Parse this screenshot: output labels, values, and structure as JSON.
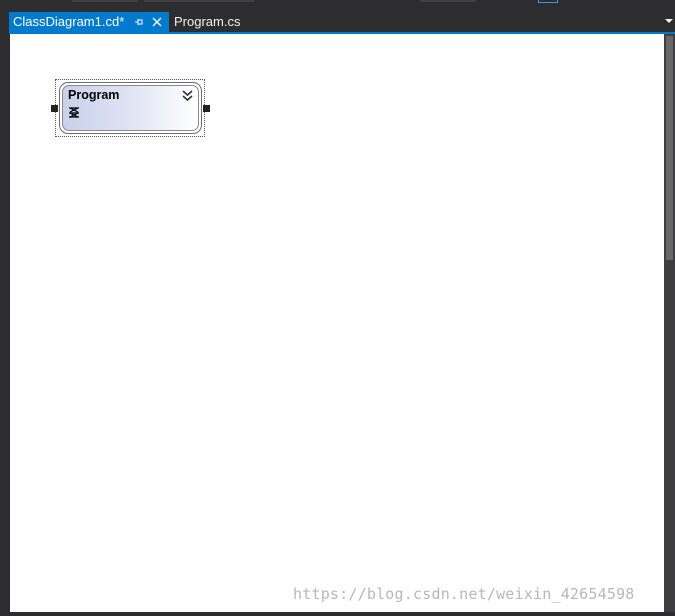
{
  "tabs": [
    {
      "label": "ClassDiagram1.cd*",
      "active": true
    },
    {
      "label": "Program.cs",
      "active": false
    }
  ],
  "tab_icons": {
    "pin": "pin-icon",
    "close": "close-icon",
    "overflow": "chevron-down-icon"
  },
  "diagram": {
    "class_shape": {
      "name": "Program",
      "kind_icon": "static-class-icon",
      "expand_icon": "chevron-double-down-icon"
    }
  },
  "watermark": "https://blog.csdn.net/weixin_42654598",
  "colors": {
    "accent": "#007acc",
    "chrome": "#2d2d30",
    "canvas": "#ffffff",
    "shape_gradient_start": "#c9d0ea"
  }
}
